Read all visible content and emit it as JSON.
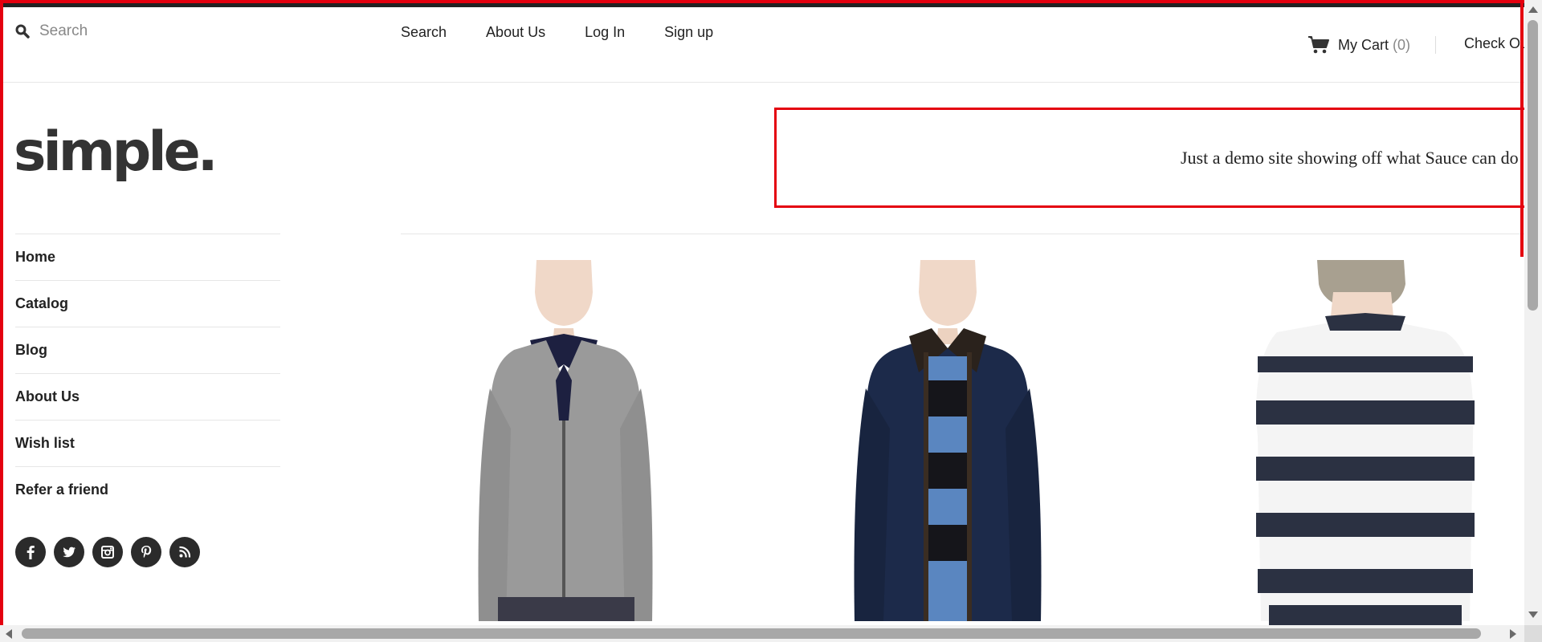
{
  "header": {
    "search_placeholder": "Search",
    "nav": [
      "Search",
      "About Us",
      "Log In",
      "Sign up"
    ],
    "cart_label": "My Cart",
    "cart_count": "(0)",
    "checkout_label": "Check Out"
  },
  "logo": "simple.",
  "banner": {
    "text": "Just a demo site showing off what Sauce can do"
  },
  "sidebar": {
    "items": [
      {
        "label": "Home"
      },
      {
        "label": "Catalog"
      },
      {
        "label": "Blog"
      },
      {
        "label": "About Us"
      },
      {
        "label": "Wish list"
      },
      {
        "label": "Refer a friend"
      }
    ],
    "socials": [
      "facebook-icon",
      "twitter-icon",
      "instagram-icon",
      "pinterest-icon",
      "rss-icon"
    ]
  },
  "products": [
    {
      "image": "grey-zip-jacket"
    },
    {
      "image": "navy-jacket-striped-sweater"
    },
    {
      "image": "striped-sweater-back"
    }
  ],
  "colors": {
    "accent_red": "#e4000f",
    "text": "#222222",
    "muted": "#888888"
  }
}
